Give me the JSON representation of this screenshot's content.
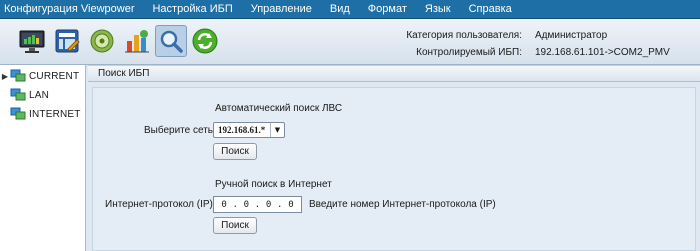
{
  "menu": {
    "items": [
      {
        "label": "Конфигурация Viewpower"
      },
      {
        "label": "Настройка ИБП"
      },
      {
        "label": "Управление"
      },
      {
        "label": "Вид"
      },
      {
        "label": "Формат"
      },
      {
        "label": "Язык"
      },
      {
        "label": "Справка"
      }
    ]
  },
  "toolbar": {
    "buttons": [
      "monitor-icon",
      "config-icon",
      "ups-disc-icon",
      "chart-icon",
      "search-icon",
      "refresh-icon"
    ],
    "active": "search-icon"
  },
  "info": {
    "user_category_label": "Категория пользователя:",
    "user_category_value": "Администратор",
    "controlled_ups_label": "Контролируемый ИБП:",
    "controlled_ups_value": "192.168.61.101->COM2_PMV"
  },
  "tree": {
    "items": [
      {
        "label": "CURRENT",
        "icon": "network-icon",
        "selected": true
      },
      {
        "label": "LAN",
        "icon": "network-icon"
      },
      {
        "label": "INTERNET",
        "icon": "network-icon"
      }
    ]
  },
  "panel": {
    "title": "Поиск ИБП",
    "auto": {
      "heading": "Автоматический поиск ЛВС",
      "network_label": "Выберите сеть",
      "network_value": "192.168.61.*",
      "search_button": "Поиск"
    },
    "manual": {
      "heading": "Ручной поиск в Интернет",
      "ip_label": "Интернет-протокол (IP)",
      "ip_octets": [
        "0",
        "0",
        "0",
        "0"
      ],
      "ip_hint": "Введите номер Интернет-протокола (IP)",
      "search_button": "Поиск"
    }
  },
  "colors": {
    "menubar": "#1d6fa5",
    "background": "#dfe8f2"
  }
}
